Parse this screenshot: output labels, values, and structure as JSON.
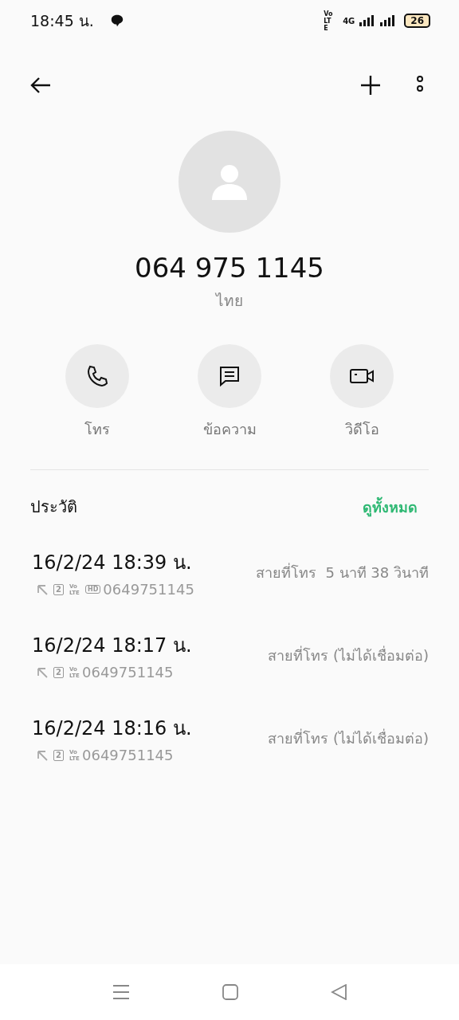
{
  "status_bar": {
    "time": "18:45 น.",
    "volte": "Vo LTE",
    "network": "4G",
    "battery": "26"
  },
  "contact": {
    "number": "064 975 1145",
    "location": "ไทย"
  },
  "actions": [
    {
      "kind": "call",
      "label": "โทร"
    },
    {
      "kind": "message",
      "label": "ข้อความ"
    },
    {
      "kind": "video",
      "label": "วิดีโอ"
    }
  ],
  "history": {
    "title": "ประวัติ",
    "view_all": "ดูทั้งหมด",
    "entries": [
      {
        "datetime": "16/2/24 18:39 น.",
        "tags": [
          {
            "kind": "sim",
            "text": "2"
          },
          {
            "kind": "volte",
            "text": "Vo LTE"
          },
          {
            "kind": "hd",
            "text": "HD"
          }
        ],
        "number": "0649751145",
        "status": "สายที่โทร  5 นาที 38 วินาที"
      },
      {
        "datetime": "16/2/24 18:17 น.",
        "tags": [
          {
            "kind": "sim",
            "text": "2"
          },
          {
            "kind": "volte",
            "text": "Vo LTE"
          }
        ],
        "number": "0649751145",
        "status": "สายที่โทร (ไม่ได้เชื่อมต่อ)"
      },
      {
        "datetime": "16/2/24 18:16 น.",
        "tags": [
          {
            "kind": "sim",
            "text": "2"
          },
          {
            "kind": "volte",
            "text": "Vo LTE"
          }
        ],
        "number": "0649751145",
        "status": "สายที่โทร (ไม่ได้เชื่อมต่อ)"
      }
    ]
  }
}
